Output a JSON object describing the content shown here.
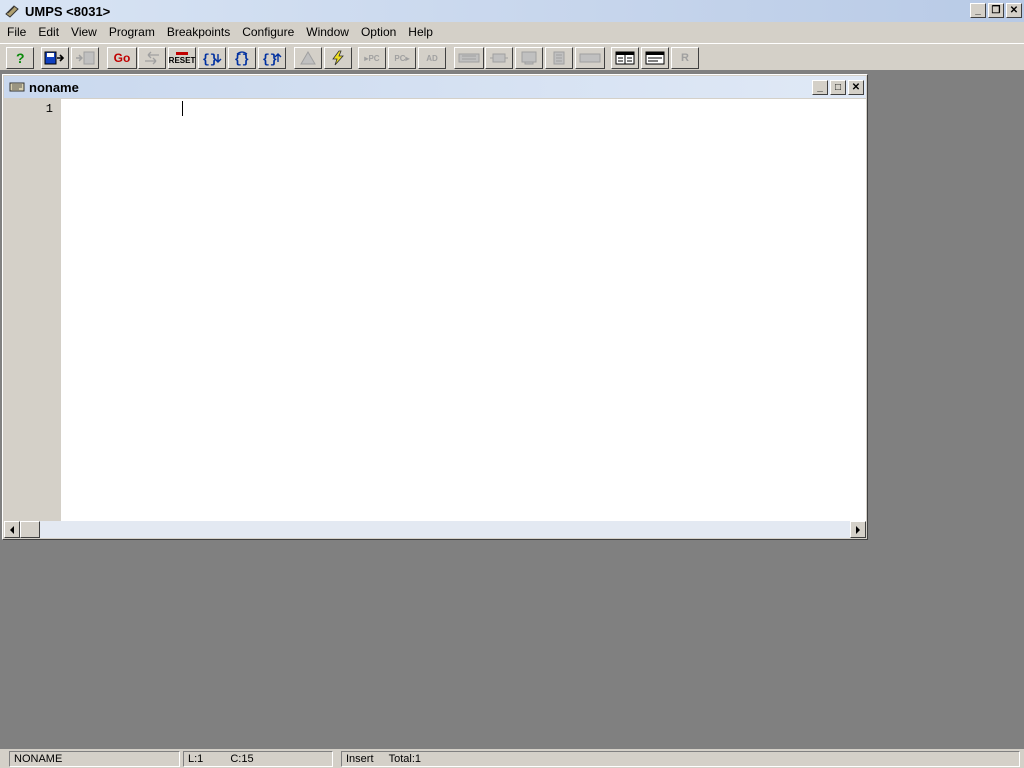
{
  "window": {
    "title": "UMPS <8031>",
    "icon": "umps-app-icon"
  },
  "title_buttons": [
    {
      "name": "minimize",
      "glyph": "_"
    },
    {
      "name": "restore",
      "glyph": "❐"
    },
    {
      "name": "close",
      "glyph": "✕"
    }
  ],
  "menu": [
    "File",
    "Edit",
    "View",
    "Program",
    "Breakpoints",
    "Configure",
    "Window",
    "Option",
    "Help"
  ],
  "toolbar": {
    "go_label": "Go",
    "reset_label": "RESET",
    "pc_label": "PC",
    "ad_label": "AD",
    "r_label": "R"
  },
  "editor": {
    "title": "noname",
    "icon": "document-icon",
    "line_numbers": [
      "1"
    ],
    "content": ""
  },
  "child_buttons": [
    {
      "name": "minimize",
      "glyph": "_"
    },
    {
      "name": "maximize",
      "glyph": "□"
    },
    {
      "name": "close",
      "glyph": "✕"
    }
  ],
  "status": {
    "file": "NONAME",
    "line": "L:1",
    "column": "C:15",
    "mode": "Insert",
    "total": "Total:1"
  }
}
